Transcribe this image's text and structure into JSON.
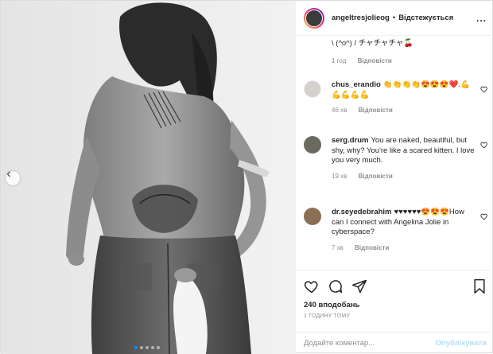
{
  "header": {
    "username": "angeltresjolieog",
    "separator": "•",
    "follow_label": "Відстежується",
    "more_label": "..."
  },
  "comments": [
    {
      "user": "",
      "text": "\\ (^o^) / チャチャチャ🍒",
      "time": "1 год",
      "likes": "",
      "reply": "Відповісти",
      "avatar_color": ""
    },
    {
      "user": "chus_erandio",
      "text": "👏👏👏👏😍😍😍❤️.💪💪💪💪💪",
      "time": "46 хв",
      "likes": "",
      "reply": "Відповісти",
      "avatar_color": "#d4d0cc"
    },
    {
      "user": "serg.drum",
      "text": "You are naked, beautiful, but shy, why? You're like a scared kitten. I love you very much.",
      "time": "19 хв",
      "likes": "",
      "reply": "Відповісти",
      "avatar_color": "#6b6a5e"
    },
    {
      "user": "dr.seyedebrahim",
      "text": "♥♥♥♥♥♥😍😍😍How can I connect with Angelina Jolie in cyberspace?",
      "time": "7 хв",
      "likes": "",
      "reply": "Відповісти",
      "avatar_color": "#8a6f55"
    }
  ],
  "actions": {
    "likes": "240 вподобань",
    "timeago": "1 ГОДИНУ ТОМУ"
  },
  "add_comment": {
    "placeholder": "Додайте коментар...",
    "publish_label": "Опублікувати"
  },
  "colors": {
    "accent": "#0095f6",
    "publish_disabled": "#b2dffc",
    "meta_text": "#8e8e8e"
  },
  "carousel": {
    "slide_count": 5,
    "active_slide": 1
  }
}
